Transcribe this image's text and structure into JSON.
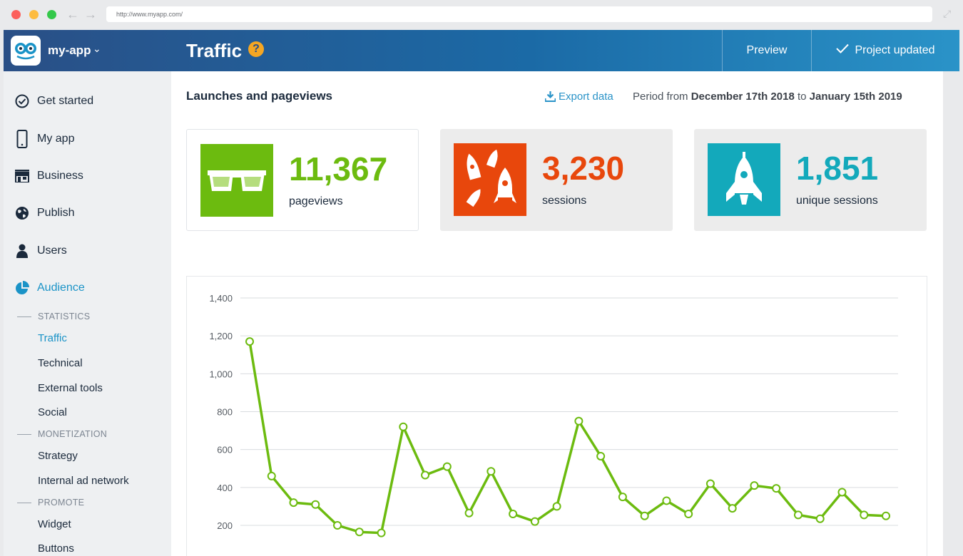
{
  "browser": {
    "url": "http://www.myapp.com/"
  },
  "header": {
    "app_name": "my-app",
    "page_title": "Traffic",
    "help_label": "?",
    "preview_label": "Preview",
    "updated_label": "Project updated"
  },
  "sidebar": {
    "items": [
      {
        "label": "Get started",
        "icon": "check-circle-icon"
      },
      {
        "label": "My app",
        "icon": "phone-icon"
      },
      {
        "label": "Business",
        "icon": "store-icon"
      },
      {
        "label": "Publish",
        "icon": "globe-icon"
      },
      {
        "label": "Users",
        "icon": "user-icon"
      },
      {
        "label": "Audience",
        "icon": "pie-chart-icon",
        "active": true
      }
    ],
    "statistics_label": "STATISTICS",
    "statistics_items": [
      "Traffic",
      "Technical",
      "External tools",
      "Social"
    ],
    "monetization_label": "MONETIZATION",
    "monetization_items": [
      "Strategy",
      "Internal ad network"
    ],
    "promote_label": "PROMOTE",
    "promote_items": [
      "Widget",
      "Buttons"
    ]
  },
  "main": {
    "section_title": "Launches and pageviews",
    "export_label": "Export data",
    "period_prefix": "Period from",
    "period_start": "December 17th 2018",
    "period_to": "to",
    "period_end": "January 15th 2019",
    "stats": [
      {
        "value": "11,367",
        "label": "pageviews",
        "color": "#6cbb0f",
        "icon": "glasses-icon"
      },
      {
        "value": "3,230",
        "label": "sessions",
        "color": "#e8470c",
        "icon": "rockets-icon"
      },
      {
        "value": "1,851",
        "label": "unique sessions",
        "color": "#13a9bb",
        "icon": "rocket-icon"
      }
    ]
  },
  "chart_data": {
    "type": "line",
    "y_ticks": [
      "1,400",
      "1,200",
      "1,000",
      "800",
      "600",
      "400",
      "200"
    ],
    "ylim": [
      200,
      1400
    ],
    "line_color": "#6cbb0f",
    "series": [
      {
        "values": [
          1170,
          460,
          320,
          310,
          200,
          165,
          160,
          720,
          465,
          510,
          265,
          485,
          260,
          220,
          300,
          750,
          565,
          350,
          250,
          330,
          260,
          420,
          290,
          410,
          395,
          255,
          235,
          375,
          255,
          250
        ]
      }
    ]
  }
}
